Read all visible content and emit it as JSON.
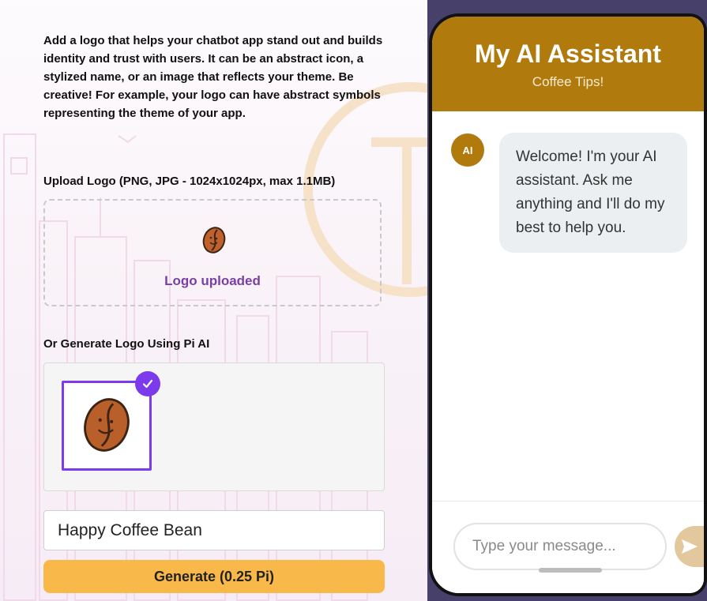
{
  "form": {
    "intro": "Add a logo that helps your chatbot app stand out and builds identity and trust with users. It can be an abstract icon, a stylized name, or an image that reflects your theme. Be creative! For example, your logo can have abstract symbols representing the theme of your app.",
    "upload_label": "Upload Logo (PNG, JPG - 1024x1024px, max 1.1MB)",
    "upload_status": "Logo uploaded",
    "generate_label": "Or Generate Logo Using Pi AI",
    "prompt_value": "Happy Coffee Bean",
    "generate_button": "Generate (0.25 Pi)",
    "icons": {
      "uploaded": "coffee-bean-icon",
      "selected": "checkmark-icon"
    }
  },
  "preview": {
    "title": "My AI Assistant",
    "subtitle": "Coffee Tips!",
    "avatar_text": "AI",
    "welcome_message": "Welcome! I'm your AI assistant. Ask me anything and I'll do my best to help you.",
    "input_placeholder": "Type your message...",
    "send_icon": "send-icon"
  },
  "colors": {
    "brand": "#b07a0d",
    "accent_purple": "#7c3aed",
    "upload_text": "#7a3fa6",
    "generate_button": "#f9b84a",
    "send_button": "#e3c89e",
    "preview_bg": "#47406b"
  }
}
